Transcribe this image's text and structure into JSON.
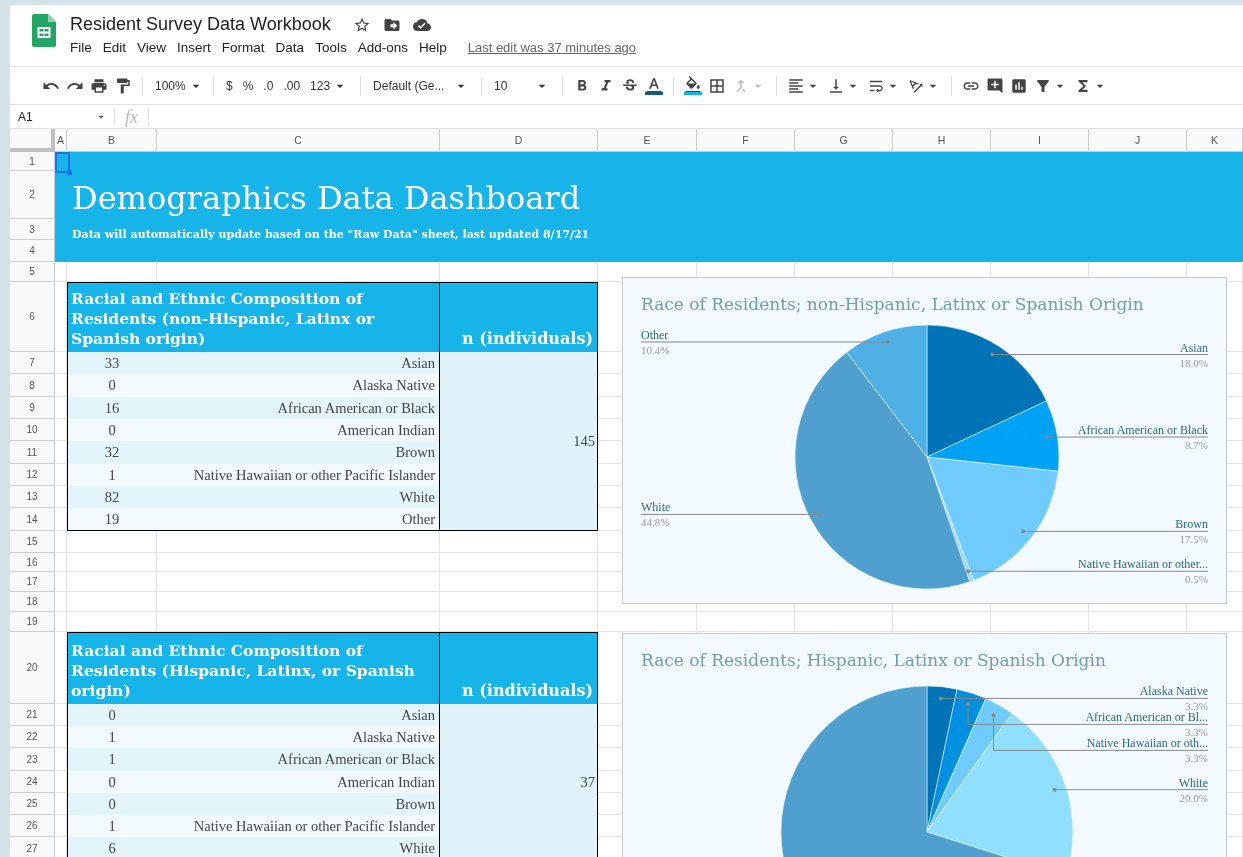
{
  "app": {
    "title": "Resident Survey Data Workbook",
    "menu": [
      "File",
      "Edit",
      "View",
      "Insert",
      "Format",
      "Data",
      "Tools",
      "Add-ons",
      "Help"
    ],
    "last_edit": "Last edit was 37 minutes ago"
  },
  "toolbar": {
    "zoom": "100%",
    "currency": "$",
    "percent": "%",
    "decimal_less": ".0",
    "decimal_more": ".00",
    "number_format": "123",
    "font": "Default (Ge...",
    "font_size": "10"
  },
  "formula_bar": {
    "cell": "A1",
    "fx": "fx"
  },
  "columns": [
    "A",
    "B",
    "C",
    "D",
    "E",
    "F",
    "G",
    "H",
    "I",
    "J",
    "K"
  ],
  "rows": [
    "1",
    "2",
    "3",
    "4",
    "5",
    "6",
    "7",
    "8",
    "9",
    "10",
    "11",
    "12",
    "13",
    "14",
    "15",
    "16",
    "17",
    "18",
    "19",
    "20",
    "21",
    "22",
    "23",
    "24",
    "25",
    "26",
    "27"
  ],
  "dashboard": {
    "title": "Demographics Data Dashboard",
    "subtitle": "Data will automatically update based on the \"Raw Data\" sheet, last updated 8/17/21"
  },
  "tables": [
    {
      "heading": "Racial and Ethnic Composition of Residents (non-Hispanic, Latinx or Spanish origin)",
      "n_heading": "n (individuals)",
      "total": "145",
      "rows": [
        {
          "count": "33",
          "label": "Asian"
        },
        {
          "count": "0",
          "label": "Alaska Native"
        },
        {
          "count": "16",
          "label": "African American or Black"
        },
        {
          "count": "0",
          "label": "American Indian"
        },
        {
          "count": "32",
          "label": "Brown"
        },
        {
          "count": "1",
          "label": "Native Hawaiian or other Pacific Islander"
        },
        {
          "count": "82",
          "label": "White"
        },
        {
          "count": "19",
          "label": "Other"
        }
      ]
    },
    {
      "heading": "Racial and Ethnic Composition of Residents (Hispanic, Latinx, or Spanish origin)",
      "n_heading": "n (individuals)",
      "total": "37",
      "rows": [
        {
          "count": "0",
          "label": "Asian"
        },
        {
          "count": "1",
          "label": "Alaska Native"
        },
        {
          "count": "1",
          "label": "African American or Black"
        },
        {
          "count": "0",
          "label": "American Indian"
        },
        {
          "count": "0",
          "label": "Brown"
        },
        {
          "count": "1",
          "label": "Native Hawaiian or other Pacific Islander"
        },
        {
          "count": "6",
          "label": "White"
        }
      ]
    }
  ],
  "charts": [
    {
      "chart_data": {
        "type": "pie",
        "title": "Race of Residents; non-Hispanic, Latinx or Spanish Origin",
        "categories": [
          "Asian",
          "African American or Black",
          "Brown",
          "Native Hawaiian or other...",
          "White",
          "Other"
        ],
        "values": [
          18.0,
          8.7,
          17.5,
          0.5,
          44.8,
          10.4
        ],
        "value_labels": [
          "18.0%",
          "8.7%",
          "17.5%",
          "0.5%",
          "44.8%",
          "10.4%"
        ]
      }
    },
    {
      "chart_data": {
        "type": "pie",
        "title": "Race of Residents; Hispanic, Latinx or Spanish Origin",
        "categories": [
          "Alaska Native",
          "African American or Bl...",
          "Native Hawaiian or oth...",
          "White",
          null
        ],
        "values": [
          3.3,
          3.3,
          3.3,
          20.0,
          70.1
        ],
        "value_labels": [
          "3.3%",
          "3.3%",
          "3.3%",
          "20.0%",
          null
        ]
      }
    }
  ]
}
